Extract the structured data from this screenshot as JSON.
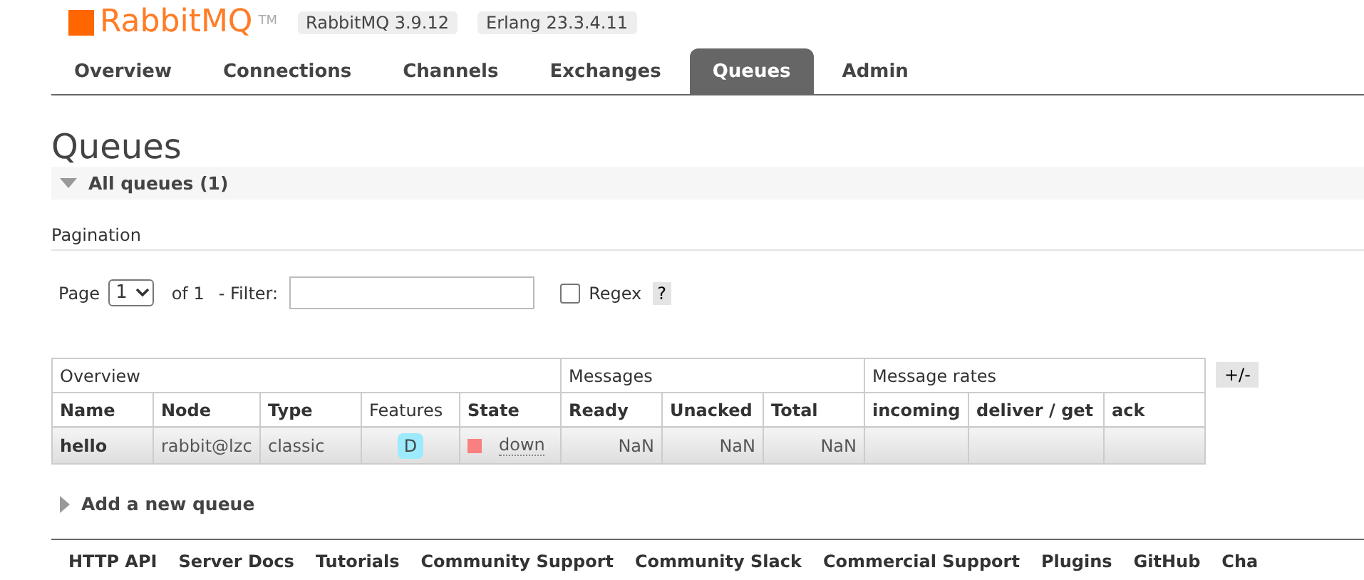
{
  "header": {
    "logo_text": "RabbitMQ",
    "trademark": "TM",
    "versions": [
      "RabbitMQ 3.9.12",
      "Erlang 23.3.4.11"
    ]
  },
  "tabs": [
    {
      "label": "Overview",
      "selected": false
    },
    {
      "label": "Connections",
      "selected": false
    },
    {
      "label": "Channels",
      "selected": false
    },
    {
      "label": "Exchanges",
      "selected": false
    },
    {
      "label": "Queues",
      "selected": true
    },
    {
      "label": "Admin",
      "selected": false
    }
  ],
  "page_title": "Queues",
  "section": {
    "title": "All queues (1)",
    "expanded": true
  },
  "pagination": {
    "title": "Pagination",
    "page_label": "Page",
    "page_value": "1",
    "of_label": "of 1",
    "filter_label": "- Filter:",
    "regex_label": "Regex",
    "regex_checked": false,
    "help": "?"
  },
  "table": {
    "groups": [
      "Overview",
      "Messages",
      "Message rates"
    ],
    "columns": [
      "Name",
      "Node",
      "Type",
      "Features",
      "State",
      "Ready",
      "Unacked",
      "Total",
      "incoming",
      "deliver / get",
      "ack"
    ],
    "rows": [
      {
        "name": "hello",
        "node": "rabbit@lzc",
        "type": "classic",
        "features": [
          "D"
        ],
        "state": {
          "label": "down",
          "color": "#f88080"
        },
        "ready": "NaN",
        "unacked": "NaN",
        "total": "NaN"
      }
    ],
    "columns_button": "+/-"
  },
  "add_section": {
    "title": "Add a new queue",
    "expanded": false
  },
  "footer": [
    "HTTP API",
    "Server Docs",
    "Tutorials",
    "Community Support",
    "Community Slack",
    "Commercial Support",
    "Plugins",
    "GitHub",
    "Cha"
  ]
}
